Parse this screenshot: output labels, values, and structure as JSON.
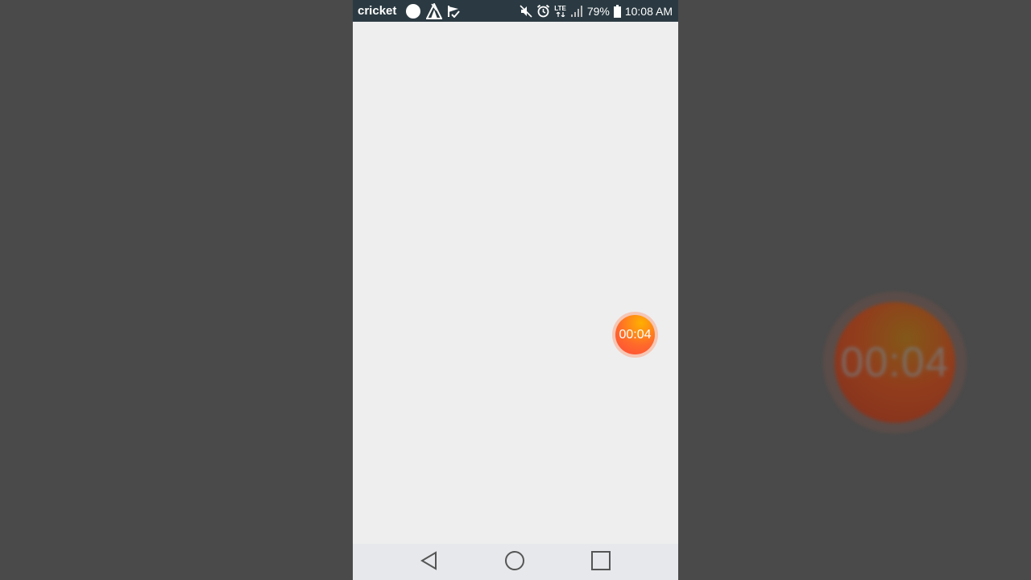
{
  "status_bar": {
    "carrier": "cricket",
    "notification_icons": [
      "circle-icon",
      "tent-icon",
      "flag-check-icon"
    ],
    "system_icons": [
      "mute-icon",
      "alarm-icon",
      "lte-icon",
      "signal-icon"
    ],
    "lte_label": "LTE",
    "battery": "79%",
    "time": "10:08 AM"
  },
  "recorder": {
    "elapsed": "00:04",
    "accent_start": "#ffb000",
    "accent_end": "#ff4a3a"
  },
  "background_preview": {
    "elapsed": "00:04"
  },
  "nav_bar": {
    "buttons": [
      "back-icon",
      "home-icon",
      "recents-icon"
    ]
  }
}
